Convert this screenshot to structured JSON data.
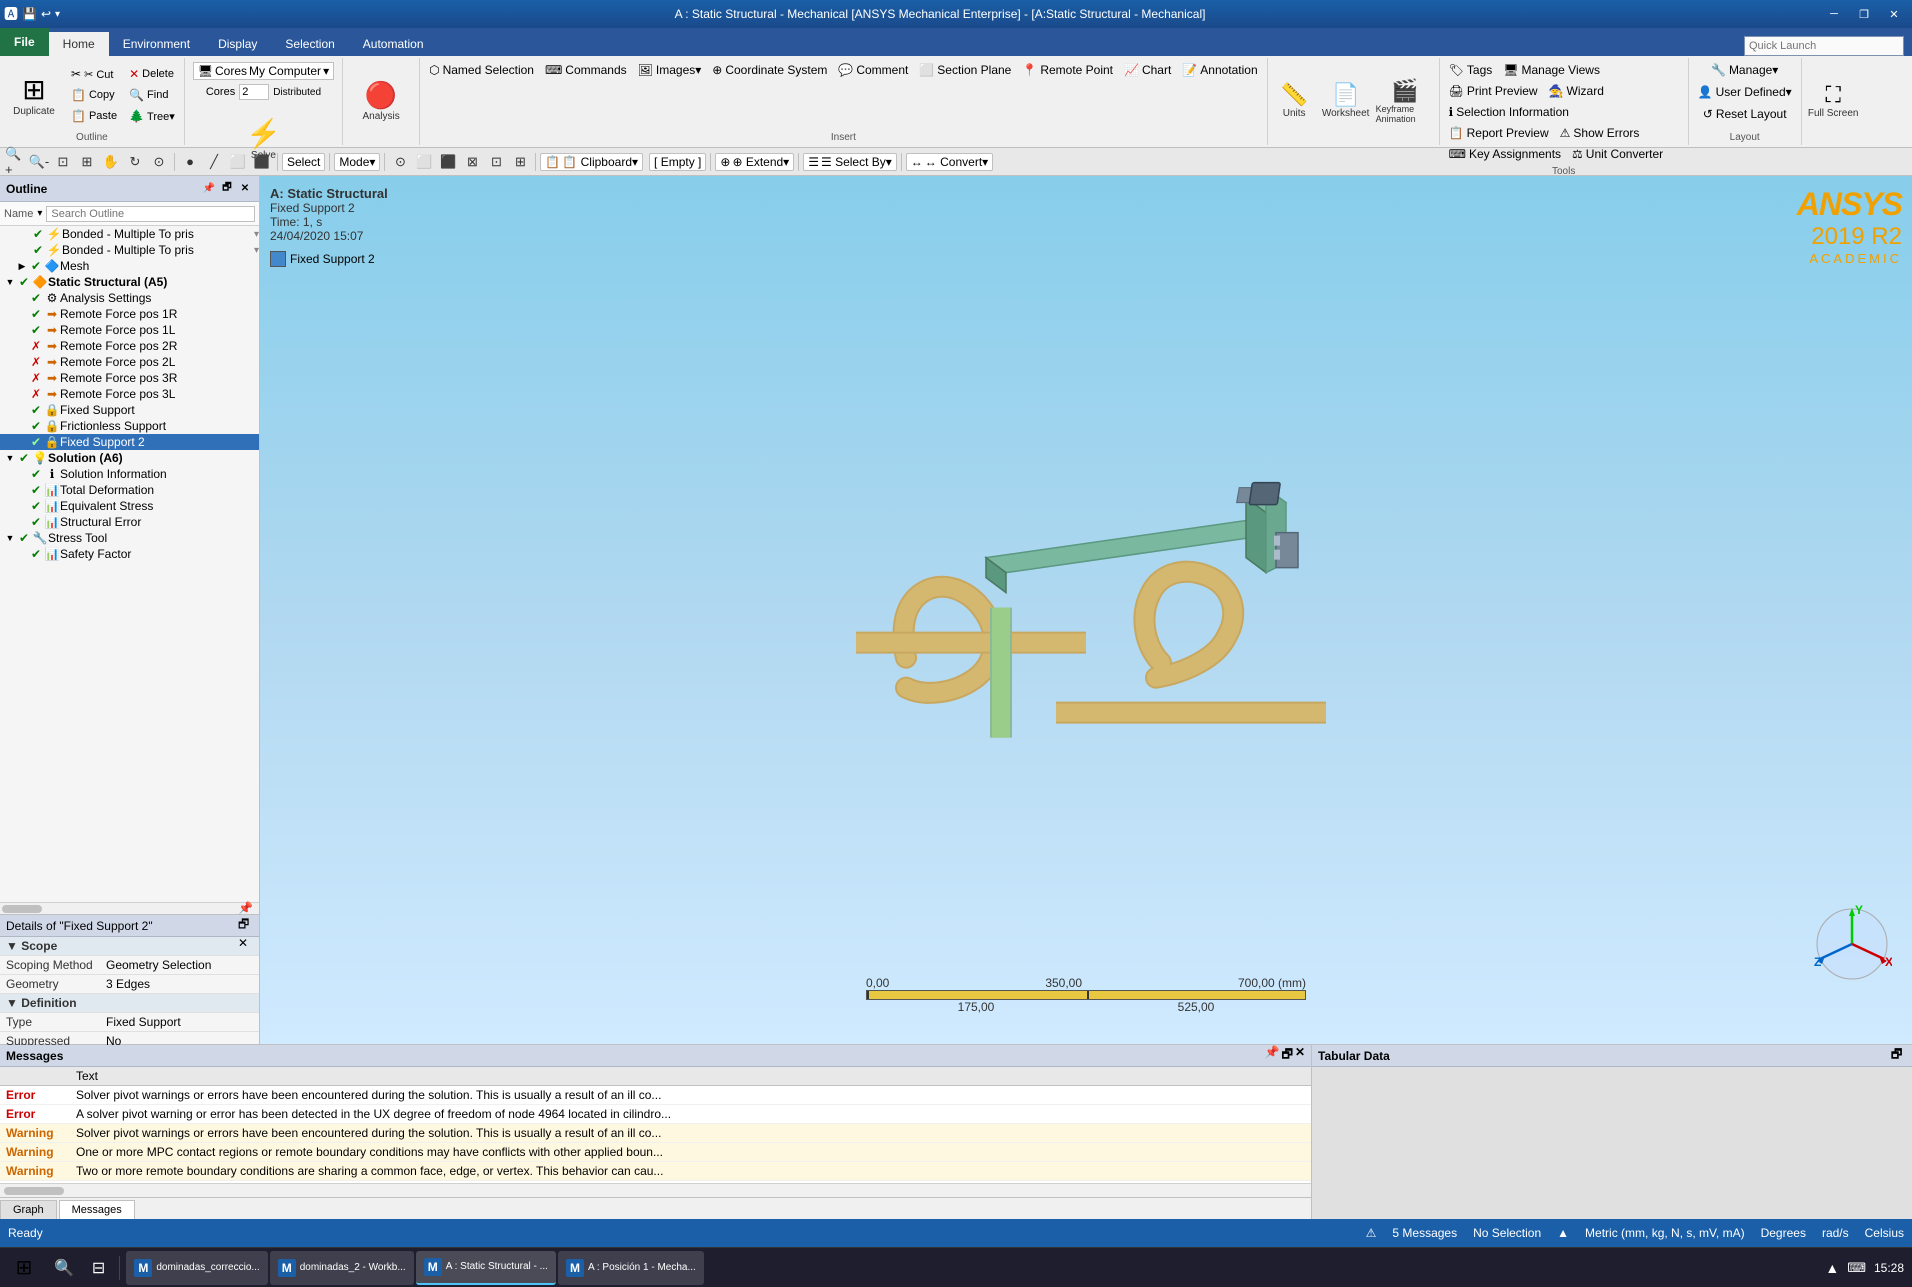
{
  "window": {
    "title": "A : Static Structural - Mechanical [ANSYS Mechanical Enterprise] - [A:Static Structural - Mechanical]",
    "min": "─",
    "restore": "❐",
    "close": "✕"
  },
  "ribbon_tabs": {
    "file": "File",
    "home": "Home",
    "environment": "Environment",
    "display": "Display",
    "selection": "Selection",
    "automation": "Automation",
    "quick_launch_placeholder": "Quick Launch"
  },
  "outline_group": {
    "label": "Outline",
    "duplicate": "Duplicate",
    "cut": "✂ Cut",
    "copy": "📋 Copy",
    "paste": "📋 Paste",
    "delete": "🗑 Delete",
    "find": "🔍 Find",
    "tree": "🌳 Tree▾",
    "cores_label": "Cores",
    "cores_value": "2",
    "solve": "Solve",
    "solve_label": "Solve"
  },
  "insert_group": {
    "label": "Insert",
    "named_selection": "Named Selection",
    "coordinate_system": "Coordinate System",
    "remote_point": "Remote Point",
    "commands": "Commands",
    "images": "Images▾",
    "comment": "Comment",
    "section_plane": "Section Plane",
    "annotation": "Annotation",
    "chart": "Chart"
  },
  "analysis_group": {
    "label": "Analysis",
    "analysis": "Analysis"
  },
  "units_group": {
    "label": "",
    "units": "Units",
    "worksheet": "Worksheet",
    "keyframe_animation": "Keyframe Animation",
    "tags": "Tags",
    "wizard": "Wizard",
    "selection_information": "Selection Information",
    "show_errors": "Show Errors",
    "unit_converter": "Unit Converter"
  },
  "tools_group": {
    "label": "Tools",
    "manage_views": "Manage Views",
    "print_preview": "Print Preview",
    "report_preview": "Report Preview",
    "key_assignments": "Key Assignments",
    "manage": "Manage▾",
    "user_defined": "User Defined▾",
    "reset_layout": "Reset Layout"
  },
  "layout_group": {
    "label": "Layout",
    "full_screen": "Full Screen"
  },
  "toolbar": {
    "zoom_in": "🔍+",
    "zoom_out": "🔍-",
    "fit": "⊡",
    "select": "Select",
    "mode": "Mode▾",
    "clipboard": "📋 Clipboard▾",
    "empty": "[ Empty ]",
    "extend": "⊕ Extend▾",
    "select_by": "☰ Select By▾",
    "convert": "↔ Convert▾"
  },
  "outline": {
    "title": "Outline",
    "search_placeholder": "Search Outline",
    "name_label": "Name",
    "items": [
      {
        "id": "bonded1",
        "label": "Bonded - Multiple To pris",
        "level": 2,
        "icon": "⚡",
        "status": "ok",
        "expanded": false
      },
      {
        "id": "bonded2",
        "label": "Bonded - Multiple To pris",
        "level": 2,
        "icon": "⚡",
        "status": "ok",
        "expanded": false
      },
      {
        "id": "mesh",
        "label": "Mesh",
        "level": 1,
        "icon": "🔷",
        "status": "ok",
        "expanded": false
      },
      {
        "id": "static_structural",
        "label": "Static Structural (A5)",
        "level": 0,
        "icon": "🔶",
        "status": "active",
        "expanded": true
      },
      {
        "id": "analysis_settings",
        "label": "Analysis Settings",
        "level": 1,
        "icon": "⚙",
        "status": "ok",
        "expanded": false
      },
      {
        "id": "remote_force_1r",
        "label": "Remote Force pos 1R",
        "level": 1,
        "icon": "➡",
        "status": "ok",
        "expanded": false
      },
      {
        "id": "remote_force_1l",
        "label": "Remote Force pos 1L",
        "level": 1,
        "icon": "➡",
        "status": "ok",
        "expanded": false
      },
      {
        "id": "remote_force_2r",
        "label": "Remote Force pos 2R",
        "level": 1,
        "icon": "✗",
        "status": "error",
        "expanded": false
      },
      {
        "id": "remote_force_2l",
        "label": "Remote Force pos 2L",
        "level": 1,
        "icon": "✗",
        "status": "error",
        "expanded": false
      },
      {
        "id": "remote_force_3r",
        "label": "Remote Force pos 3R",
        "level": 1,
        "icon": "✗",
        "status": "error",
        "expanded": false
      },
      {
        "id": "remote_force_3l",
        "label": "Remote Force pos 3L",
        "level": 1,
        "icon": "✗",
        "status": "error",
        "expanded": false
      },
      {
        "id": "fixed_support",
        "label": "Fixed Support",
        "level": 1,
        "icon": "✔",
        "status": "ok",
        "expanded": false
      },
      {
        "id": "frictionless_support",
        "label": "Frictionless Support",
        "level": 1,
        "icon": "✔",
        "status": "ok",
        "expanded": false
      },
      {
        "id": "fixed_support_2",
        "label": "Fixed Support 2",
        "level": 1,
        "icon": "✔",
        "status": "selected",
        "expanded": false,
        "selected": true
      },
      {
        "id": "solution",
        "label": "Solution (A6)",
        "level": 0,
        "icon": "💡",
        "status": "active",
        "expanded": true
      },
      {
        "id": "solution_info",
        "label": "Solution Information",
        "level": 1,
        "icon": "ℹ",
        "status": "ok",
        "expanded": false
      },
      {
        "id": "total_deformation",
        "label": "Total Deformation",
        "level": 1,
        "icon": "📊",
        "status": "ok",
        "expanded": false
      },
      {
        "id": "equivalent_stress",
        "label": "Equivalent Stress",
        "level": 1,
        "icon": "📊",
        "status": "ok",
        "expanded": false
      },
      {
        "id": "structural_error",
        "label": "Structural Error",
        "level": 1,
        "icon": "📊",
        "status": "ok",
        "expanded": false
      },
      {
        "id": "stress_tool",
        "label": "Stress Tool",
        "level": 0,
        "icon": "🔧",
        "status": "ok",
        "expanded": true
      },
      {
        "id": "safety_factor",
        "label": "Safety Factor",
        "level": 1,
        "icon": "📊",
        "status": "ok",
        "expanded": false
      }
    ]
  },
  "details": {
    "title": "Details of \"Fixed Support 2\"",
    "sections": [
      {
        "name": "Scope",
        "rows": [
          {
            "label": "Scoping Method",
            "value": "Geometry Selection"
          },
          {
            "label": "Geometry",
            "value": "3 Edges"
          }
        ]
      },
      {
        "name": "Definition",
        "rows": [
          {
            "label": "Type",
            "value": "Fixed Support"
          },
          {
            "label": "Suppressed",
            "value": "No"
          }
        ]
      }
    ]
  },
  "viewport": {
    "analysis_title": "A: Static Structural",
    "item_title": "Fixed Support 2",
    "time_label": "Time: 1, s",
    "date_label": "24/04/2020 15:07",
    "legend_label": "Fixed Support 2",
    "scale": {
      "labels_top": [
        "0,00",
        "350,00",
        "700,00 (mm)"
      ],
      "labels_bottom": [
        "175,00",
        "525,00"
      ]
    }
  },
  "ansys": {
    "logo": "ANSYS",
    "version": "2019 R2",
    "edition": "ACADEMIC"
  },
  "messages": {
    "title": "Messages",
    "column_text": "Text",
    "rows": [
      {
        "type": "Error",
        "text": "Solver pivot warnings or errors have been encountered during the solution.  This is usually a result of an ill co..."
      },
      {
        "type": "Error",
        "text": "A solver pivot warning or error has been detected in the UX degree of freedom of node 4964 located in cilindro..."
      },
      {
        "type": "Warning",
        "text": "Solver pivot warnings or errors have been encountered during the solution.  This is usually a result of an ill co..."
      },
      {
        "type": "Warning",
        "text": "One or more MPC contact regions or remote boundary conditions may have conflicts with other applied boun..."
      },
      {
        "type": "Warning",
        "text": "Two or more remote boundary conditions are sharing a common face, edge, or vertex.   This behavior can cau..."
      }
    ],
    "tabs": [
      "Graph",
      "Messages"
    ]
  },
  "tabular": {
    "title": "Tabular Data"
  },
  "status_bar": {
    "status": "Ready",
    "messages_count": "5 Messages",
    "no_selection": "No Selection",
    "units": "Metric (mm, kg, N, s, mV, mA)",
    "degrees": "Degrees",
    "radians": "rad/s",
    "celsius": "Celsius"
  },
  "taskbar": {
    "items": [
      {
        "label": "dominadas_correccio...",
        "icon": "M",
        "active": false
      },
      {
        "label": "dominadas_2 - Workb...",
        "icon": "M",
        "active": false
      },
      {
        "label": "A : Static Structural - ...",
        "icon": "M",
        "active": true
      },
      {
        "label": "A : Posición 1 - Mecha...",
        "icon": "M",
        "active": false
      }
    ],
    "time": "15:28"
  },
  "colors": {
    "accent_blue": "#1a5fa8",
    "ribbon_blue": "#2b579a",
    "selected_blue": "#0078d7",
    "warning_bg": "#fff8e0",
    "error_red": "#cc0000",
    "warning_orange": "#cc6600"
  }
}
